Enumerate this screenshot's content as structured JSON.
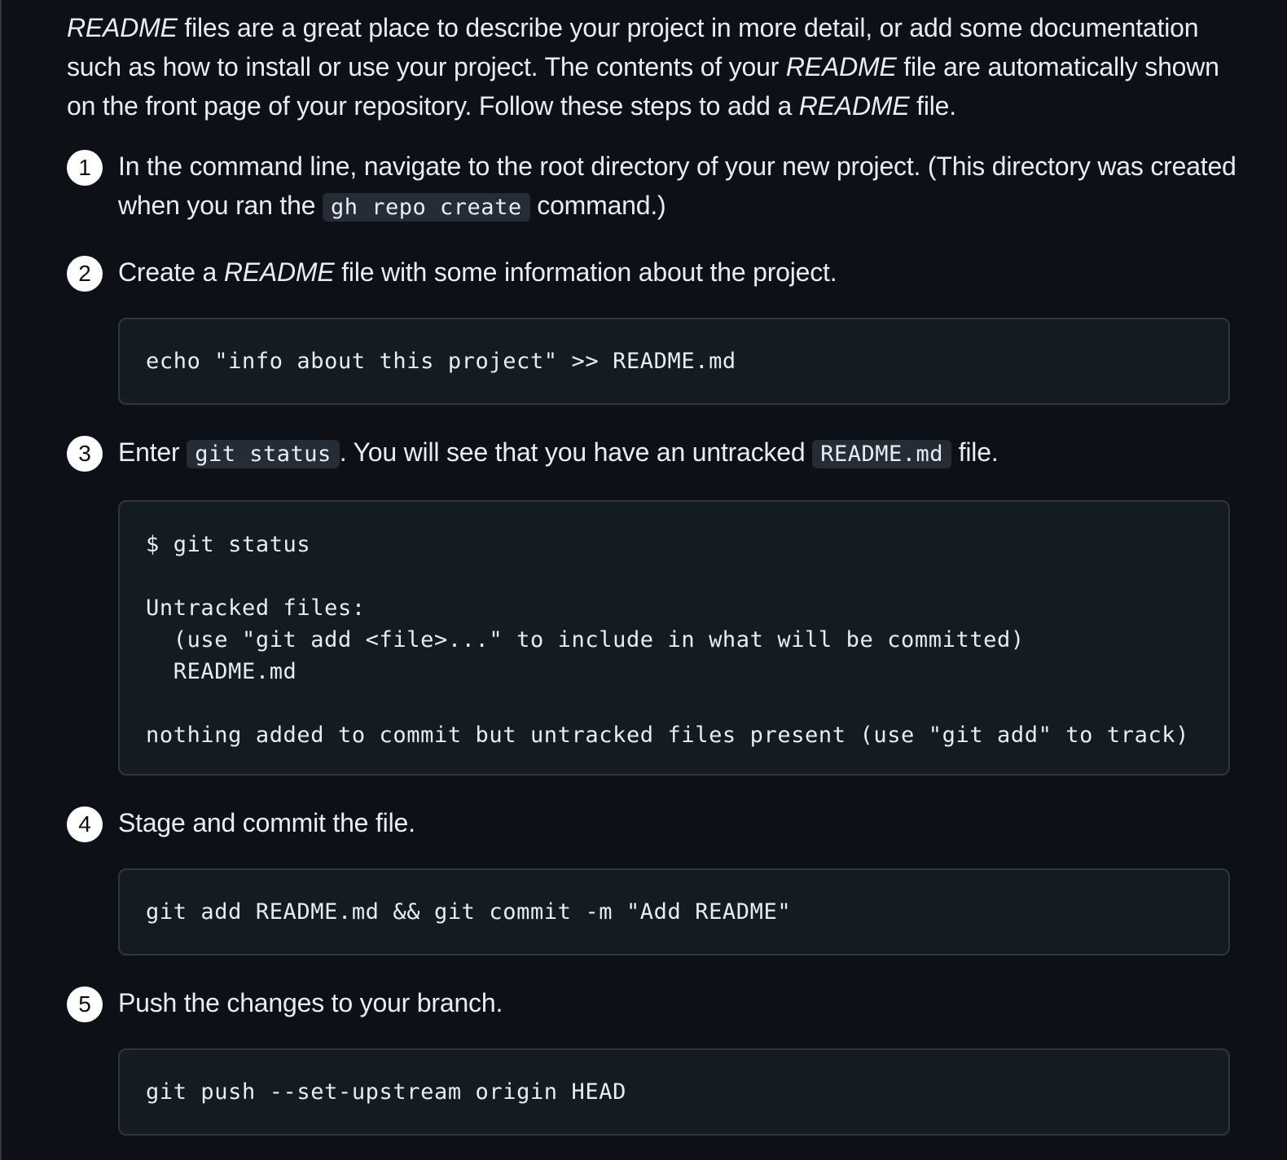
{
  "intro": {
    "parts": [
      {
        "t": "README",
        "em": true
      },
      {
        "t": " files are a great place to describe your project in more detail, or add some documentation such as how to install or use your project. The contents of your "
      },
      {
        "t": "README",
        "em": true
      },
      {
        "t": " file are automatically shown on the front page of your repository. Follow these steps to add a "
      },
      {
        "t": "README",
        "em": true
      },
      {
        "t": " file."
      }
    ]
  },
  "steps": [
    {
      "number": "1",
      "parts": [
        {
          "t": "In the command line, navigate to the root directory of your new project. (This directory was created when you ran the "
        },
        {
          "t": "gh repo create",
          "code": true
        },
        {
          "t": " command.)"
        }
      ],
      "code_lines": []
    },
    {
      "number": "2",
      "parts": [
        {
          "t": "Create a "
        },
        {
          "t": "README",
          "em": true
        },
        {
          "t": " file with some information about the project."
        }
      ],
      "code_lines": [
        "echo \"info about this project\" >> README.md"
      ]
    },
    {
      "number": "3",
      "parts": [
        {
          "t": "Enter "
        },
        {
          "t": "git status",
          "code": true
        },
        {
          "t": ". You will see that you have an untracked "
        },
        {
          "t": "README.md",
          "code": true
        },
        {
          "t": " file."
        }
      ],
      "code_lines": [
        "$ git status",
        "",
        "Untracked files:",
        "  (use \"git add <file>...\" to include in what will be committed)",
        "  README.md",
        "",
        "nothing added to commit but untracked files present (use \"git add\" to track)"
      ]
    },
    {
      "number": "4",
      "parts": [
        {
          "t": "Stage and commit the file."
        }
      ],
      "code_lines": [
        "git add README.md && git commit -m \"Add README\""
      ]
    },
    {
      "number": "5",
      "parts": [
        {
          "t": "Push the changes to your branch."
        }
      ],
      "code_lines": [
        "git push --set-upstream origin HEAD"
      ]
    }
  ]
}
